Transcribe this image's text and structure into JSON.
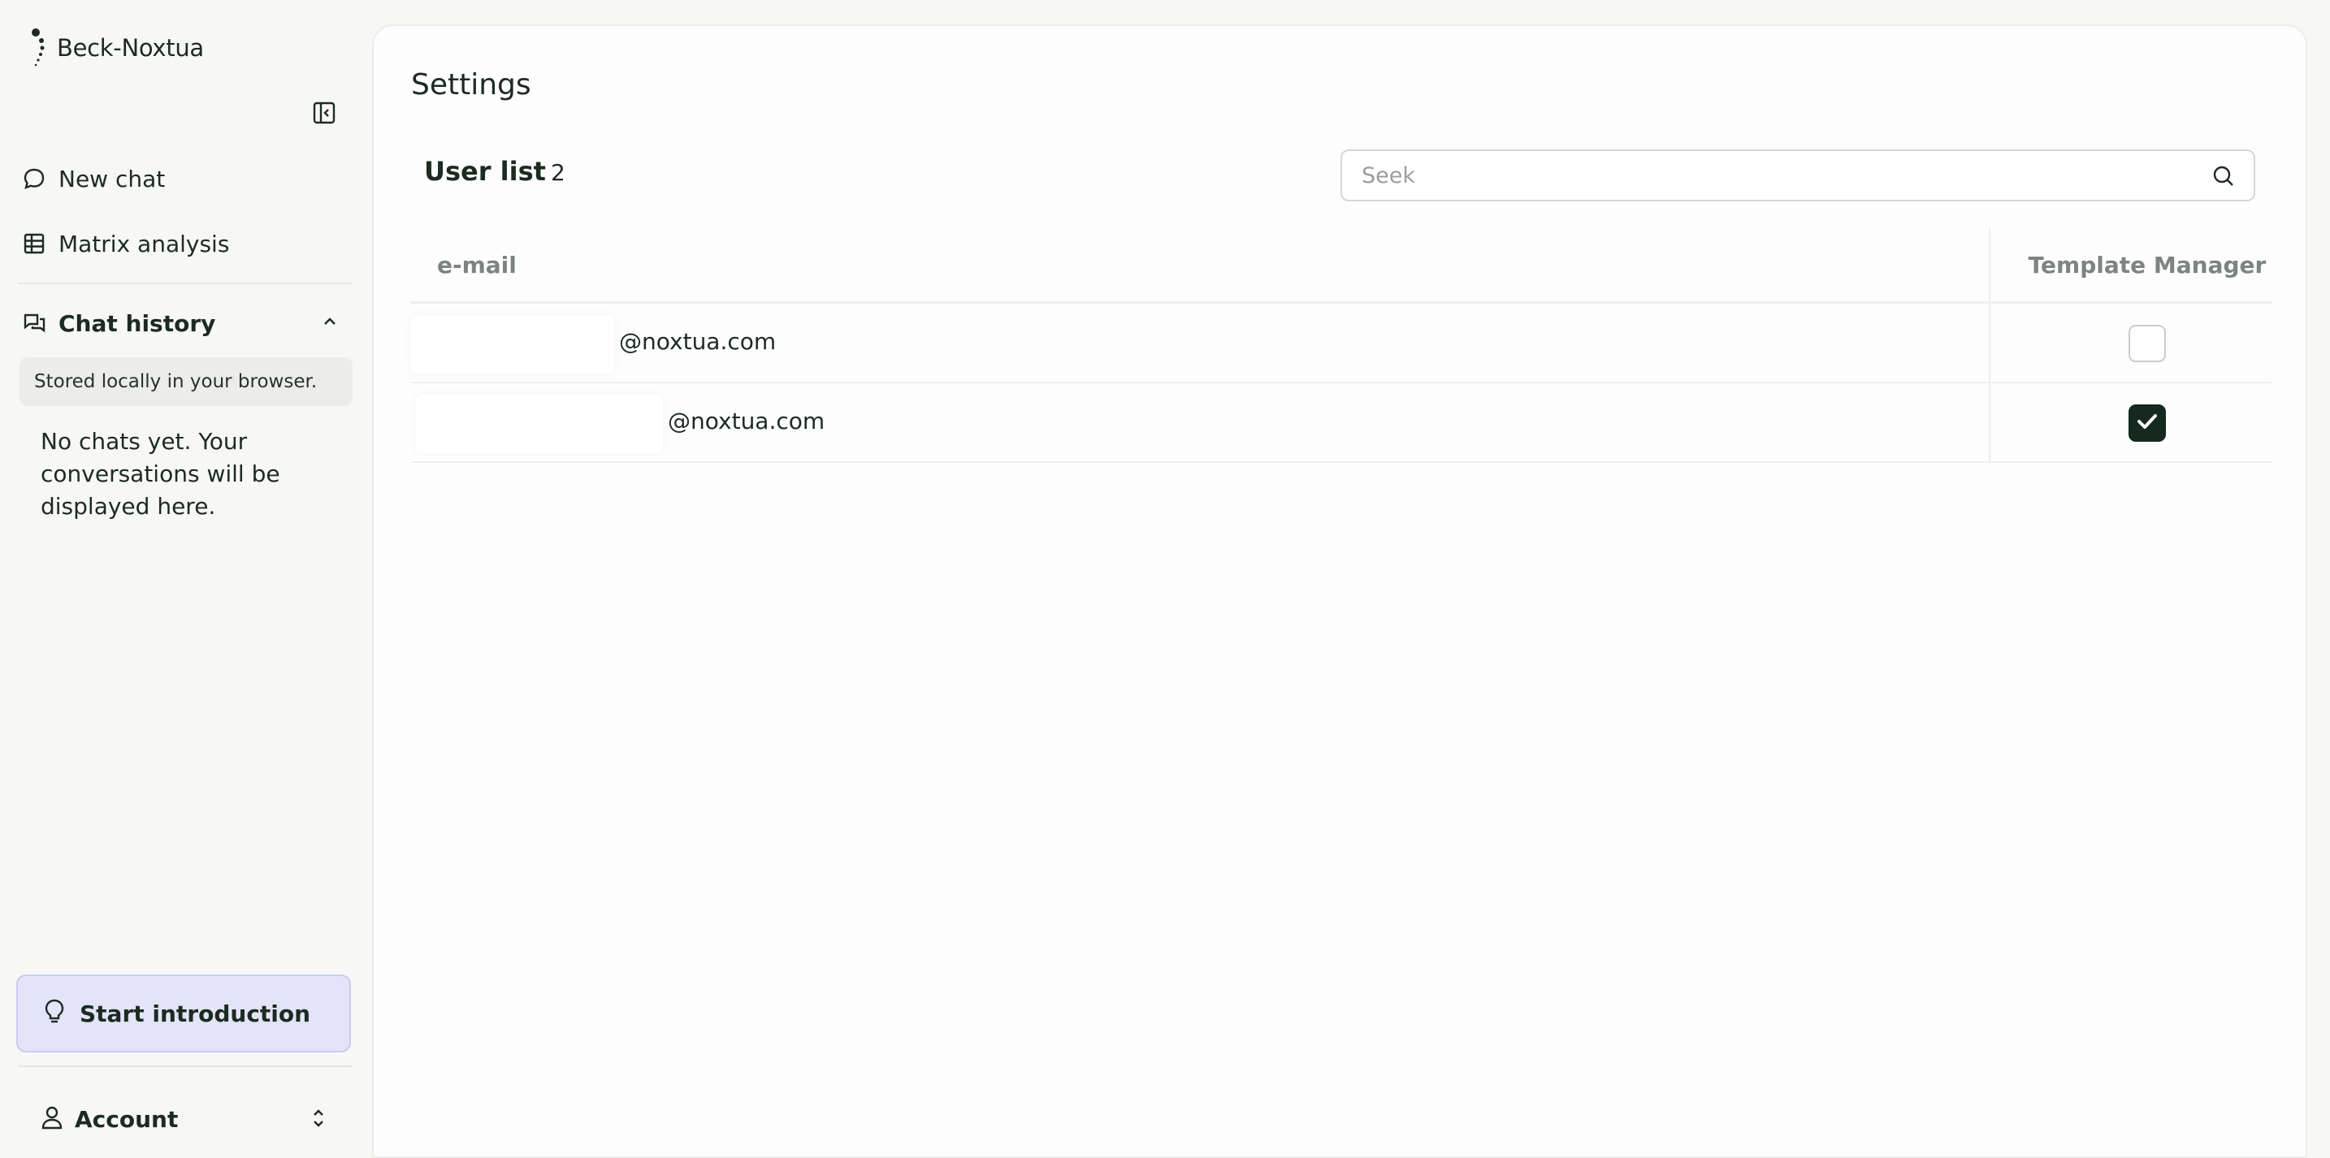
{
  "brand": {
    "name": "Beck-Noxtua"
  },
  "sidebar": {
    "nav": [
      {
        "label": "New chat",
        "icon": "chat-bubble-icon"
      },
      {
        "label": "Matrix analysis",
        "icon": "table-grid-icon"
      }
    ],
    "history": {
      "title": "Chat history",
      "stored_note": "Stored locally in your browser.",
      "empty_text": "No chats yet. Your conversations will be displayed here."
    },
    "intro_button": "Start introduction",
    "account_label": "Account"
  },
  "main": {
    "title": "Settings",
    "user_list": {
      "title": "User list",
      "count": "2",
      "search_placeholder": "Seek",
      "columns": {
        "email": "e-mail",
        "role": "Template Manager"
      },
      "rows": [
        {
          "email": "@noxtua.com",
          "template_manager": false
        },
        {
          "email": "@noxtua.com",
          "template_manager": true
        }
      ]
    }
  },
  "colors": {
    "accent": "#15291e",
    "intro_bg": "#e3e4f7",
    "sidebar_bg": "#f7f7f6"
  }
}
